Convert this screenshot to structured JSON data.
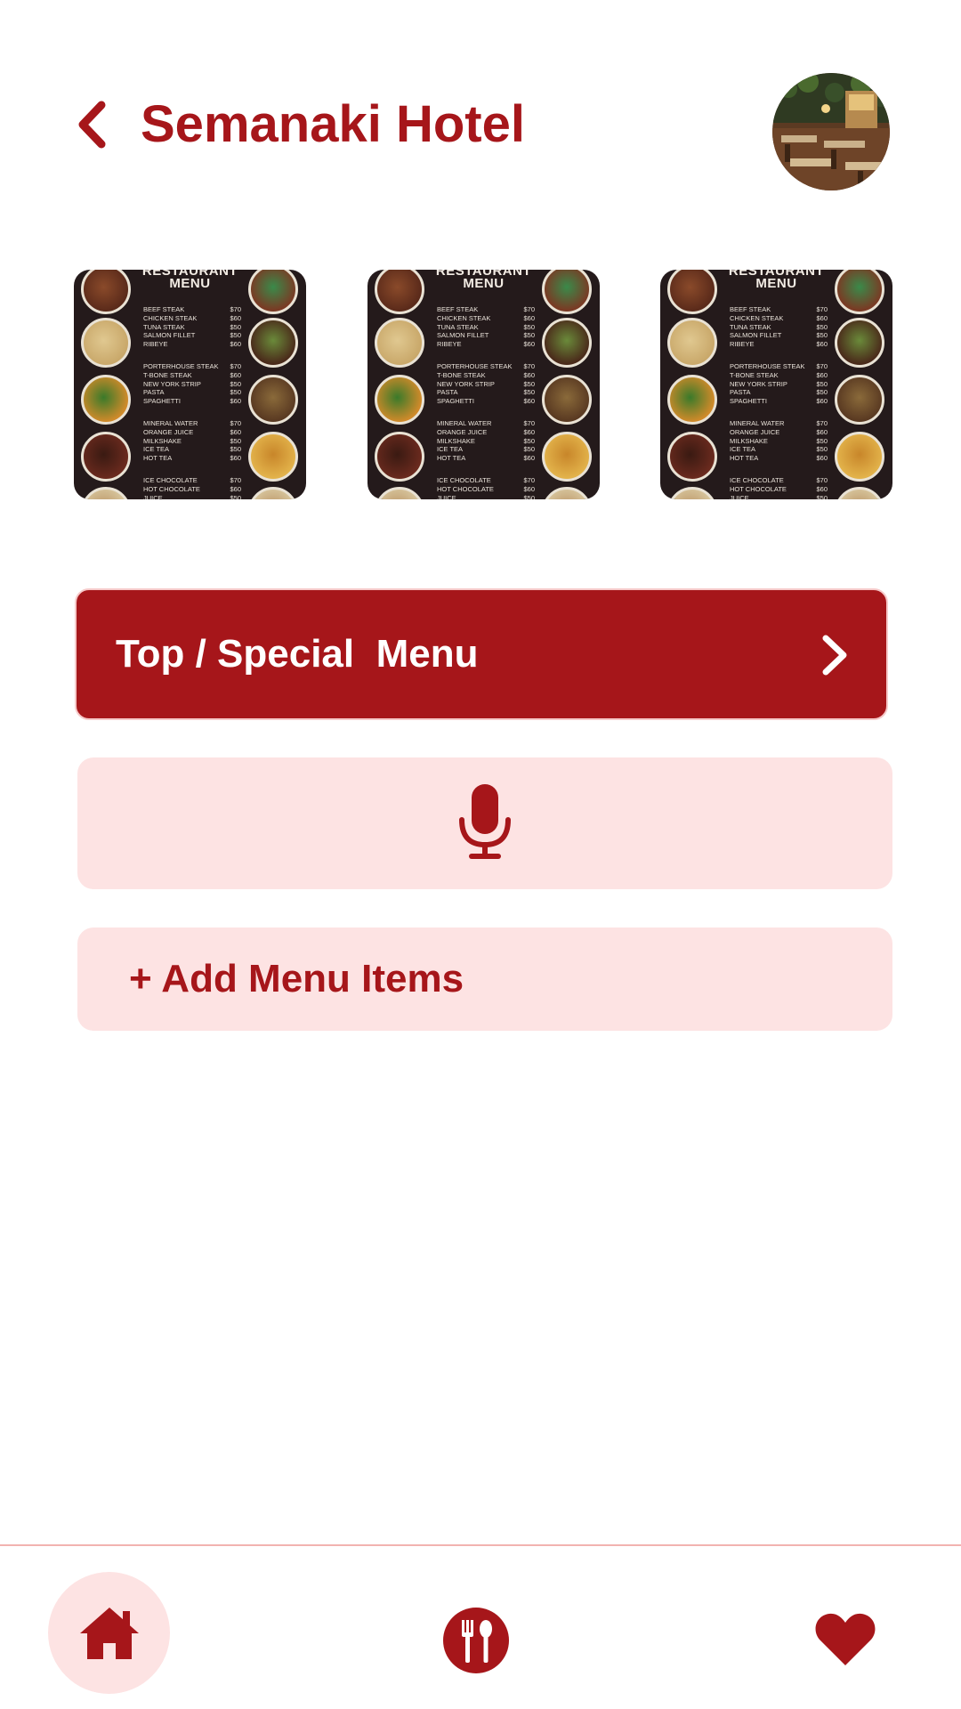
{
  "header": {
    "back_icon": "chevron-left-icon",
    "title": "Semanaki Hotel",
    "avatar_icon": "restaurant-photo"
  },
  "menu_thumbnails": [
    {
      "heading_line1": "RESTAURANT",
      "heading_line2": "MENU",
      "sections": [
        [
          [
            "BEEF STEAK",
            "$70"
          ],
          [
            "CHICKEN STEAK",
            "$60"
          ],
          [
            "TUNA STEAK",
            "$50"
          ],
          [
            "SALMON FILLET",
            "$50"
          ],
          [
            "RIBEYE",
            "$60"
          ]
        ],
        [
          [
            "PORTERHOUSE STEAK",
            "$70"
          ],
          [
            "T-BONE STEAK",
            "$60"
          ],
          [
            "NEW YORK STRIP",
            "$50"
          ],
          [
            "PASTA",
            "$50"
          ],
          [
            "SPAGHETTI",
            "$60"
          ]
        ],
        [
          [
            "MINERAL WATER",
            "$70"
          ],
          [
            "ORANGE JUICE",
            "$60"
          ],
          [
            "MILKSHAKE",
            "$50"
          ],
          [
            "ICE TEA",
            "$50"
          ],
          [
            "HOT TEA",
            "$60"
          ]
        ],
        [
          [
            "ICE CHOCOLATE",
            "$70"
          ],
          [
            "HOT CHOCOLATE",
            "$60"
          ],
          [
            "JUICE",
            "$50"
          ]
        ]
      ]
    },
    {
      "heading_line1": "RESTAURANT",
      "heading_line2": "MENU",
      "sections": [
        [
          [
            "BEEF STEAK",
            "$70"
          ],
          [
            "CHICKEN STEAK",
            "$60"
          ],
          [
            "TUNA STEAK",
            "$50"
          ],
          [
            "SALMON FILLET",
            "$50"
          ],
          [
            "RIBEYE",
            "$60"
          ]
        ],
        [
          [
            "PORTERHOUSE STEAK",
            "$70"
          ],
          [
            "T-BONE STEAK",
            "$60"
          ],
          [
            "NEW YORK STRIP",
            "$50"
          ],
          [
            "PASTA",
            "$50"
          ],
          [
            "SPAGHETTI",
            "$60"
          ]
        ],
        [
          [
            "MINERAL WATER",
            "$70"
          ],
          [
            "ORANGE JUICE",
            "$60"
          ],
          [
            "MILKSHAKE",
            "$50"
          ],
          [
            "ICE TEA",
            "$50"
          ],
          [
            "HOT TEA",
            "$60"
          ]
        ],
        [
          [
            "ICE CHOCOLATE",
            "$70"
          ],
          [
            "HOT CHOCOLATE",
            "$60"
          ],
          [
            "JUICE",
            "$50"
          ]
        ]
      ]
    },
    {
      "heading_line1": "RESTAURANT",
      "heading_line2": "MENU",
      "sections": [
        [
          [
            "BEEF STEAK",
            "$70"
          ],
          [
            "CHICKEN STEAK",
            "$60"
          ],
          [
            "TUNA STEAK",
            "$50"
          ],
          [
            "SALMON FILLET",
            "$50"
          ],
          [
            "RIBEYE",
            "$60"
          ]
        ],
        [
          [
            "PORTERHOUSE STEAK",
            "$70"
          ],
          [
            "T-BONE STEAK",
            "$60"
          ],
          [
            "NEW YORK STRIP",
            "$50"
          ],
          [
            "PASTA",
            "$50"
          ],
          [
            "SPAGHETTI",
            "$60"
          ]
        ],
        [
          [
            "MINERAL WATER",
            "$70"
          ],
          [
            "ORANGE JUICE",
            "$60"
          ],
          [
            "MILKSHAKE",
            "$50"
          ],
          [
            "ICE TEA",
            "$50"
          ],
          [
            "HOT TEA",
            "$60"
          ]
        ],
        [
          [
            "ICE CHOCOLATE",
            "$70"
          ],
          [
            "HOT CHOCOLATE",
            "$60"
          ],
          [
            "JUICE",
            "$50"
          ]
        ]
      ]
    }
  ],
  "buttons": {
    "special_label": "Top / Special  Menu",
    "special_icon": "chevron-right-icon",
    "mic_icon": "microphone-icon",
    "add_label": "+ Add Menu Items"
  },
  "bottom_nav": {
    "items": [
      {
        "icon": "home-icon",
        "active": true
      },
      {
        "icon": "fork-spoon-icon",
        "active": false
      },
      {
        "icon": "heart-icon",
        "active": false
      }
    ]
  },
  "colors": {
    "brand_red": "#a6161a",
    "light_pink": "#fde3e3",
    "divider": "#f2b3b0",
    "menu_card_bg": "#241a1b"
  }
}
